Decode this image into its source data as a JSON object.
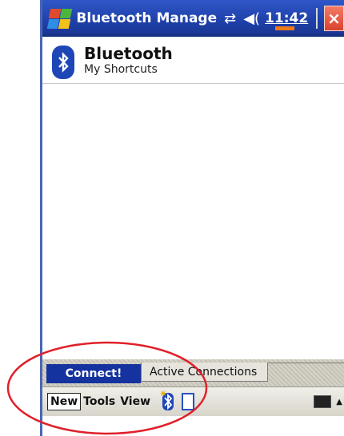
{
  "titlebar": {
    "title": "Bluetooth Manage",
    "time": "11:42",
    "close_glyph": "×",
    "icons": [
      "windows-start-icon",
      "connectivity-icon",
      "speaker-icon",
      "close-icon"
    ]
  },
  "header": {
    "title": "Bluetooth",
    "subtitle": "My Shortcuts"
  },
  "tabs": {
    "active_label": "Connect!",
    "inactive_label": "Active Connections"
  },
  "menubar": {
    "new_label": "New",
    "tools_label": "Tools",
    "view_label": "View"
  },
  "colors": {
    "titlebar": "#1e3fa8",
    "tab_active": "#14339e",
    "bluetooth_blue": "#1e46b6",
    "annotation": "#e0202a"
  }
}
